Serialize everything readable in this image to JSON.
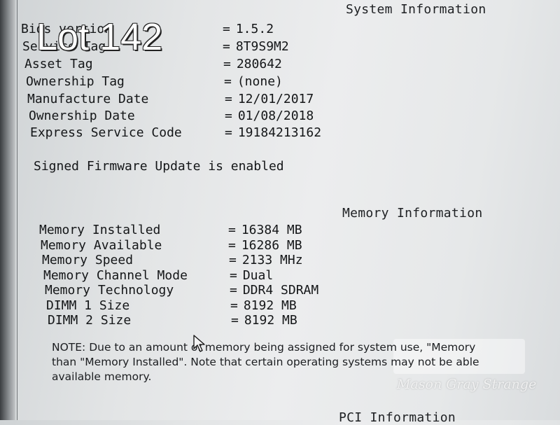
{
  "lot_label": "Lot 142",
  "system_info": {
    "title": "System Information",
    "rows": [
      {
        "label": "Bios version",
        "value": "1.5.2"
      },
      {
        "label": "Service Tag",
        "value": "8T9S9M2"
      },
      {
        "label": "Asset Tag",
        "value": "280642"
      },
      {
        "label": "Ownership Tag",
        "value": "(none)"
      },
      {
        "label": "Manufacture Date",
        "value": "12/01/2017"
      },
      {
        "label": "Ownership Date",
        "value": "01/08/2018"
      },
      {
        "label": "Express Service Code",
        "value": "19184213162"
      }
    ],
    "firmware_note": "Signed Firmware Update is enabled"
  },
  "memory_info": {
    "title": "Memory Information",
    "rows": [
      {
        "label": "Memory Installed",
        "value": "16384 MB"
      },
      {
        "label": "Memory Available",
        "value": "16286 MB"
      },
      {
        "label": "Memory Speed",
        "value": "2133 MHz"
      },
      {
        "label": "Memory Channel Mode",
        "value": "Dual"
      },
      {
        "label": "Memory Technology",
        "value": "DDR4 SDRAM"
      },
      {
        "label": "DIMM 1 Size",
        "value": "8192 MB"
      },
      {
        "label": "DIMM 2 Size",
        "value": "8192 MB"
      }
    ],
    "note_lines": [
      "NOTE: Due to an amount of memory being assigned for system use, \"Memory",
      "than \"Memory Installed\". Note that certain operating systems may not be able",
      "available memory."
    ]
  },
  "pci_info": {
    "title": "PCI Information"
  },
  "watermark": "Mason Gray Strange",
  "eq_sign": "="
}
